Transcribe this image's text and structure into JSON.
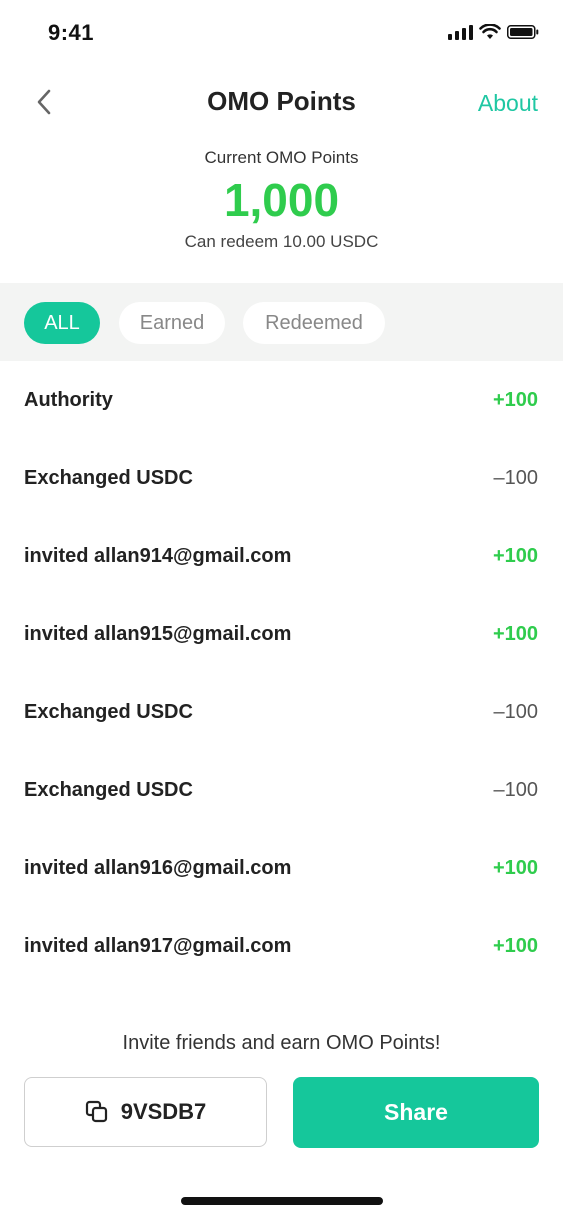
{
  "status_bar": {
    "time": "9:41"
  },
  "nav": {
    "title": "OMO Points",
    "about_label": "About"
  },
  "summary": {
    "label": "Current OMO Points",
    "points": "1,000",
    "redeem_text": "Can redeem 10.00 USDC"
  },
  "filters": [
    {
      "label": "ALL",
      "active": true
    },
    {
      "label": "Earned",
      "active": false
    },
    {
      "label": "Redeemed",
      "active": false
    }
  ],
  "transactions": [
    {
      "label": "Authority",
      "amount": "+100",
      "type": "positive"
    },
    {
      "label": "Exchanged USDC",
      "amount": "–100",
      "type": "negative"
    },
    {
      "label": "invited allan914@gmail.com",
      "amount": "+100",
      "type": "positive"
    },
    {
      "label": "invited allan915@gmail.com",
      "amount": "+100",
      "type": "positive"
    },
    {
      "label": "Exchanged USDC",
      "amount": "–100",
      "type": "negative"
    },
    {
      "label": "Exchanged USDC",
      "amount": "–100",
      "type": "negative"
    },
    {
      "label": "invited allan916@gmail.com",
      "amount": "+100",
      "type": "positive"
    },
    {
      "label": "invited allan917@gmail.com",
      "amount": "+100",
      "type": "positive"
    }
  ],
  "invite": {
    "text": "Invite friends and earn OMO Points!",
    "code": "9VSDB7",
    "share_label": "Share"
  },
  "colors": {
    "accent": "#15c79b",
    "positive": "#2fcc4d",
    "negative": "#555555"
  }
}
